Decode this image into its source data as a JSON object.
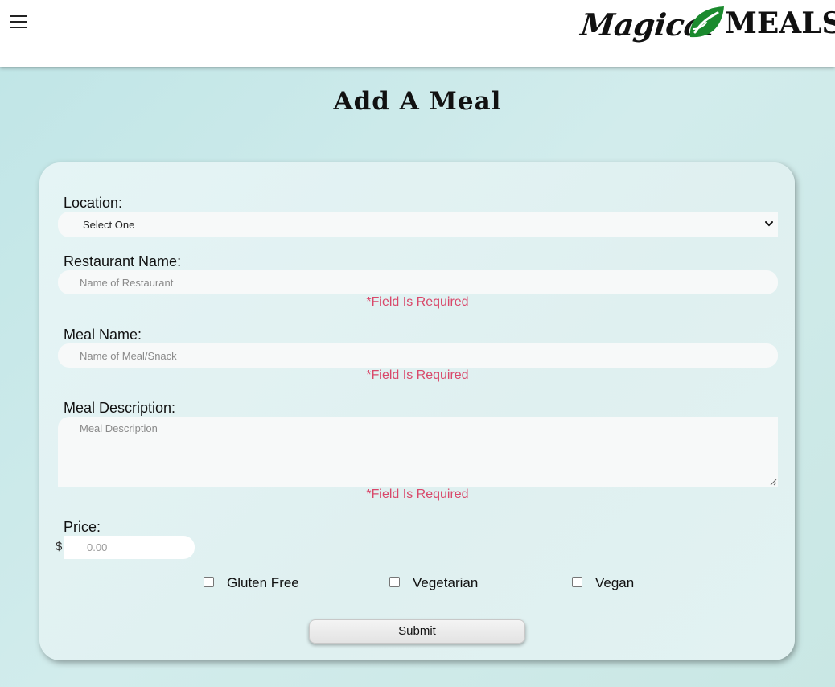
{
  "header": {
    "menu_icon": "hamburger-menu-icon",
    "logo": {
      "script_text": "Magical",
      "block_text": "MEALS",
      "leaf_color": "#1b8a2e"
    }
  },
  "page": {
    "title": "Add A Meal"
  },
  "form": {
    "location": {
      "label": "Location:",
      "selected": "Select One"
    },
    "restaurant": {
      "label": "Restaurant Name:",
      "placeholder": "Name of Restaurant",
      "error": "*Field Is Required"
    },
    "meal_name": {
      "label": "Meal Name:",
      "placeholder": "Name of Meal/Snack",
      "error": "*Field Is Required"
    },
    "description": {
      "label": "Meal Description:",
      "placeholder": "Meal Description",
      "error": "*Field Is Required"
    },
    "price": {
      "label": "Price:",
      "currency": "$",
      "placeholder": "0.00"
    },
    "options": [
      {
        "label": "Gluten Free",
        "checked": false
      },
      {
        "label": "Vegetarian",
        "checked": false
      },
      {
        "label": "Vegan",
        "checked": false
      }
    ],
    "submit_label": "Submit"
  },
  "colors": {
    "error": "#d9486a",
    "background": "#c9e7e4",
    "card": "#e2f2f2"
  }
}
